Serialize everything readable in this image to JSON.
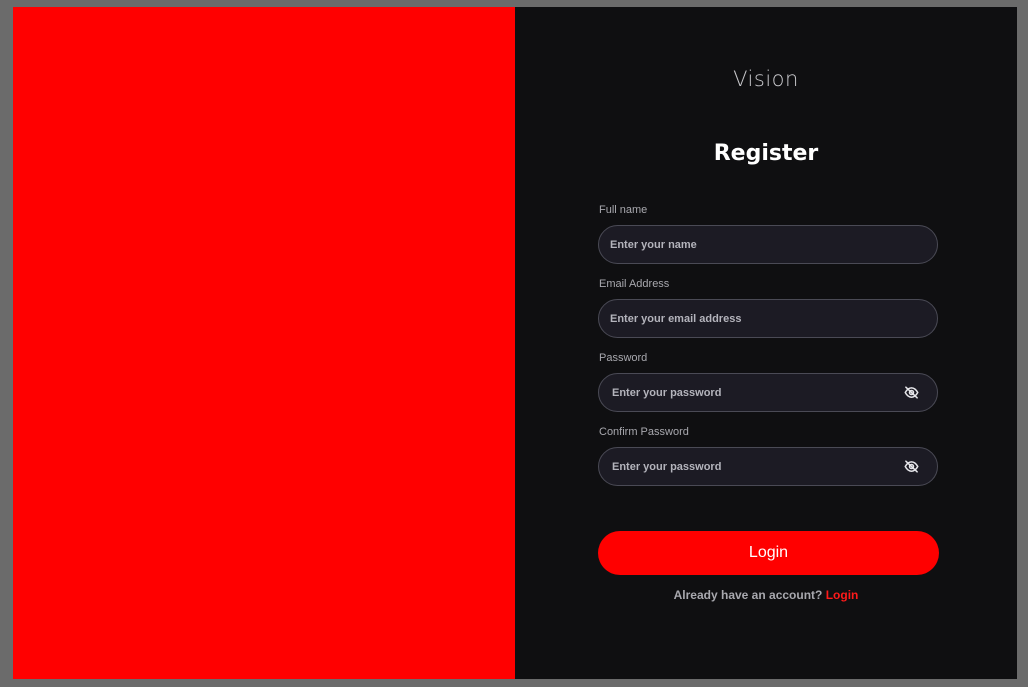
{
  "brand": "Vision",
  "title": "Register",
  "fields": {
    "full_name": {
      "label": "Full name",
      "placeholder": "Enter your name"
    },
    "email": {
      "label": "Email Address",
      "placeholder": "Enter your email address"
    },
    "password": {
      "label": "Password",
      "placeholder": "Enter your password",
      "icon": "eye-off-icon"
    },
    "confirm_password": {
      "label": "Confirm Password",
      "placeholder": "Enter your password",
      "icon": "eye-off-icon"
    }
  },
  "login_button": "Login",
  "footer": {
    "prompt": "Already have an account?",
    "link": "Login"
  },
  "colors": {
    "accent": "#ff0000",
    "panel_bg": "#0f0f11",
    "input_bg": "#1c1b24"
  }
}
